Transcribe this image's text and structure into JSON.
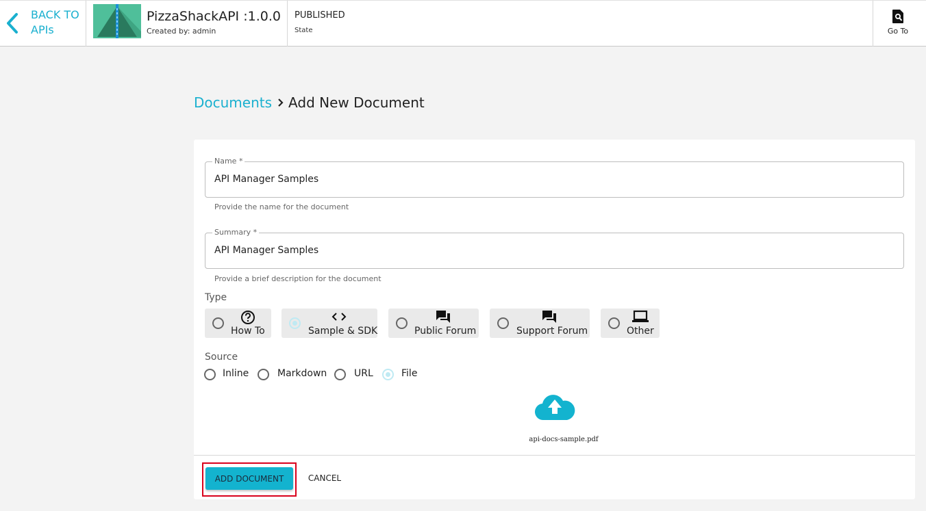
{
  "header": {
    "back_label": "BACK TO APIs",
    "api_name": "PizzaShackAPI :1.0.0",
    "created_by": "Created by: admin",
    "state_value": "PUBLISHED",
    "state_label": "State",
    "goto_label": "Go To"
  },
  "breadcrumb": {
    "parent": "Documents",
    "current": "Add New Document"
  },
  "form": {
    "name": {
      "label": "Name *",
      "value": "API Manager Samples",
      "helper": "Provide the name for the document"
    },
    "summary": {
      "label": "Summary *",
      "value": "API Manager Samples",
      "helper": "Provide a brief description for the document"
    },
    "type": {
      "label": "Type",
      "options": [
        {
          "label": "How To",
          "icon": "help-circle-icon",
          "selected": false
        },
        {
          "label": "Sample & SDK",
          "icon": "code-icon",
          "selected": true
        },
        {
          "label": "Public Forum",
          "icon": "forum-icon",
          "selected": false
        },
        {
          "label": "Support Forum",
          "icon": "forum-icon",
          "selected": false
        },
        {
          "label": "Other",
          "icon": "laptop-icon",
          "selected": false
        }
      ]
    },
    "source": {
      "label": "Source",
      "options": [
        {
          "label": "Inline",
          "selected": false
        },
        {
          "label": "Markdown",
          "selected": false
        },
        {
          "label": "URL",
          "selected": false
        },
        {
          "label": "File",
          "selected": true
        }
      ]
    },
    "file_name": "api-docs-sample.pdf",
    "add_button": "ADD DOCUMENT",
    "cancel_button": "CANCEL"
  },
  "colors": {
    "accent": "#1ab0cf",
    "button": "#13b3cf",
    "highlight_frame": "#d9001b",
    "selected_radio": "#bfeaf3"
  }
}
